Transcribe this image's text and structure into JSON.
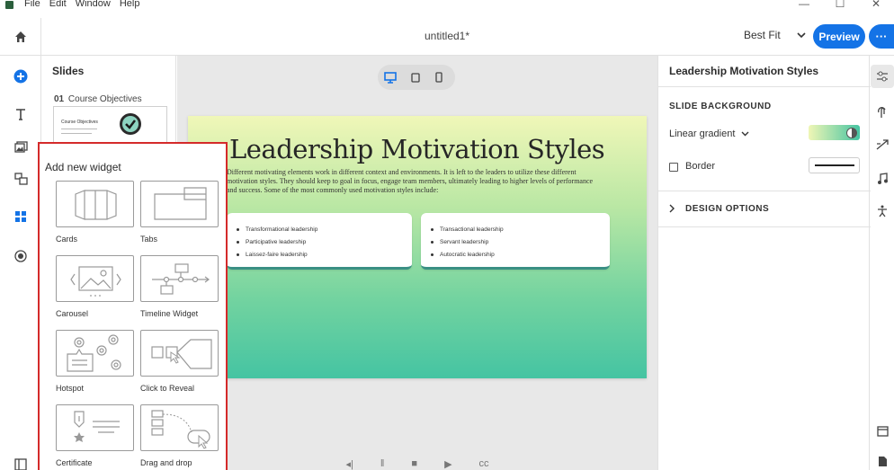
{
  "menu": [
    "File",
    "Edit",
    "Window",
    "Help"
  ],
  "window_controls": {
    "minimize": "—",
    "maximize": "☐",
    "close": "✕"
  },
  "document": {
    "title": "untitled1*"
  },
  "toolbar": {
    "fit_label": "Best Fit",
    "preview_label": "Preview",
    "more_label": "···"
  },
  "slides_panel": {
    "title": "Slides",
    "slides": [
      {
        "number": "01",
        "name": "Course Objectives",
        "thumb_title": "Course Objectives"
      }
    ]
  },
  "canvas": {
    "heading": "Leadership Motivation Styles",
    "body": "Different motivating elements work in different context and environments. It is left to the leaders to utilize these different motivation styles. They should keep to goal in focus, engage team members, ultimately leading to higher levels of performance and success. Some of the most commonly used motivation styles include:",
    "left_list": [
      "Transformational leadership",
      "Participative leadership",
      "Laissez-faire leadership"
    ],
    "right_list": [
      "Transactional leadership",
      "Servant leadership",
      "Autocratic leadership"
    ]
  },
  "properties": {
    "title": "Leadership Motivation Styles",
    "section": "SLIDE BACKGROUND",
    "fill_type": "Linear gradient",
    "border_label": "Border",
    "design_options": "DESIGN OPTIONS",
    "gradient_colors": [
      "#eff6b5",
      "#45c4a2"
    ]
  },
  "widget_popup": {
    "title": "Add new widget",
    "widgets": [
      "Cards",
      "Tabs",
      "Carousel",
      "Timeline Widget",
      "Hotspot",
      "Click to Reveal",
      "Certificate",
      "Drag and drop"
    ]
  },
  "colors": {
    "accent": "#1473e6",
    "highlight": "#d42a2a"
  }
}
